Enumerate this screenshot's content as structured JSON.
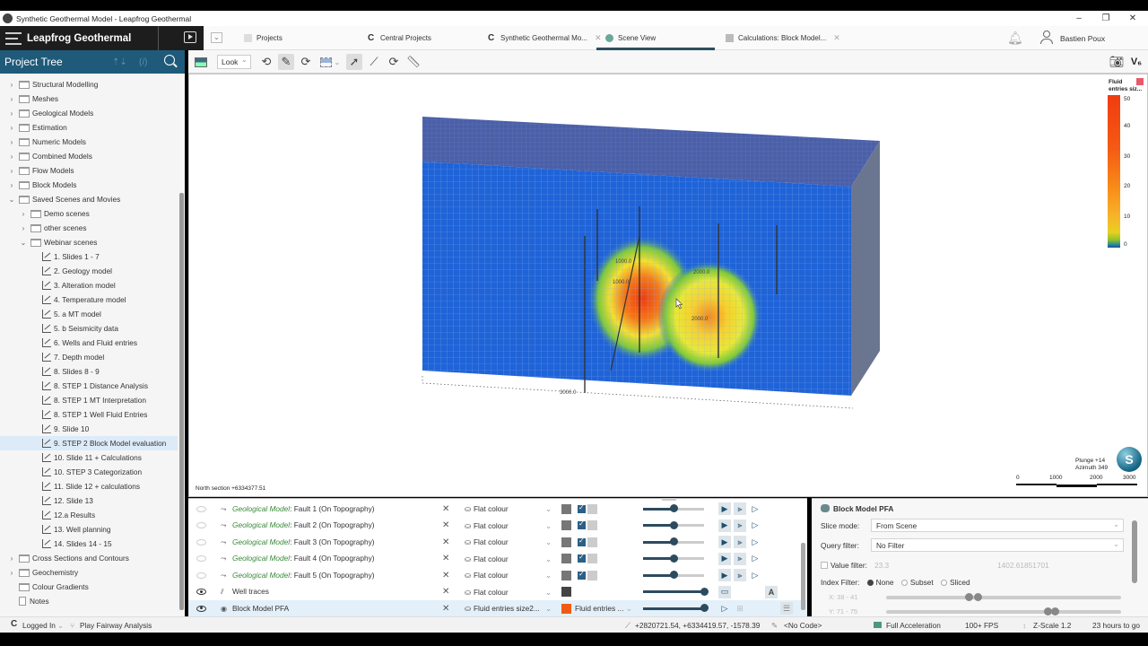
{
  "window": {
    "title": "Synthetic Geothermal Model - Leapfrog Geothermal",
    "controls": {
      "minimize": "–",
      "restore": "❐",
      "close": "✕"
    }
  },
  "brand": {
    "name": "Leapfrog Geothermal"
  },
  "tabs": [
    {
      "label": "Projects",
      "icon": "projects-icon",
      "active": false,
      "closable": false
    },
    {
      "label": "Central Projects",
      "icon": "central-icon",
      "active": false,
      "closable": false
    },
    {
      "label": "Synthetic Geothermal Mo...",
      "icon": "central-icon",
      "active": false,
      "closable": true
    },
    {
      "label": "Scene View",
      "icon": "scene-icon",
      "active": true,
      "closable": false
    },
    {
      "label": "Calculations: Block Model...",
      "icon": "calculations-icon",
      "active": false,
      "closable": true
    }
  ],
  "user": {
    "name": "Bastien Poux"
  },
  "project_tree": {
    "title": "Project Tree",
    "items": [
      {
        "label": "Structural Modelling",
        "level": 0,
        "type": "folder",
        "expanded": false
      },
      {
        "label": "Meshes",
        "level": 0,
        "type": "folder",
        "expanded": false
      },
      {
        "label": "Geological Models",
        "level": 0,
        "type": "folder",
        "expanded": false
      },
      {
        "label": "Estimation",
        "level": 0,
        "type": "folder",
        "expanded": false
      },
      {
        "label": "Numeric Models",
        "level": 0,
        "type": "folder",
        "expanded": false
      },
      {
        "label": "Combined Models",
        "level": 0,
        "type": "folder",
        "expanded": false
      },
      {
        "label": "Flow Models",
        "level": 0,
        "type": "folder",
        "expanded": false
      },
      {
        "label": "Block Models",
        "level": 0,
        "type": "folder",
        "expanded": false
      },
      {
        "label": "Saved Scenes and Movies",
        "level": 0,
        "type": "folder",
        "expanded": true
      },
      {
        "label": "Demo scenes",
        "level": 1,
        "type": "folder",
        "expanded": false
      },
      {
        "label": "other scenes",
        "level": 1,
        "type": "folder",
        "expanded": false
      },
      {
        "label": "Webinar scenes",
        "level": 1,
        "type": "folder",
        "expanded": true
      },
      {
        "label": "1. Slides 1 - 7",
        "level": 2,
        "type": "scene"
      },
      {
        "label": "2. Geology model",
        "level": 2,
        "type": "scene"
      },
      {
        "label": "3. Alteration model",
        "level": 2,
        "type": "scene"
      },
      {
        "label": "4. Temperature model",
        "level": 2,
        "type": "scene"
      },
      {
        "label": "5. a MT model",
        "level": 2,
        "type": "scene"
      },
      {
        "label": "5. b Seismicity data",
        "level": 2,
        "type": "scene"
      },
      {
        "label": "6. Wells and Fluid entries",
        "level": 2,
        "type": "scene"
      },
      {
        "label": "7. Depth model",
        "level": 2,
        "type": "scene"
      },
      {
        "label": "8. Slides 8 - 9",
        "level": 2,
        "type": "scene"
      },
      {
        "label": "8. STEP 1 Distance Analysis",
        "level": 2,
        "type": "scene"
      },
      {
        "label": "8. STEP 1 MT Interpretation",
        "level": 2,
        "type": "scene"
      },
      {
        "label": "8. STEP 1 Well Fluid Entries",
        "level": 2,
        "type": "scene"
      },
      {
        "label": "9. Slide 10",
        "level": 2,
        "type": "scene"
      },
      {
        "label": "9. STEP 2 Block Model evaluation",
        "level": 2,
        "type": "scene",
        "selected": true
      },
      {
        "label": "10. Slide 11 + Calculations",
        "level": 2,
        "type": "scene"
      },
      {
        "label": "10. STEP 3 Categorization",
        "level": 2,
        "type": "scene"
      },
      {
        "label": "11. Slide 12 + calculations",
        "level": 2,
        "type": "scene"
      },
      {
        "label": "12. Slide 13",
        "level": 2,
        "type": "scene"
      },
      {
        "label": "12.a Results",
        "level": 2,
        "type": "scene"
      },
      {
        "label": "13. Well planning",
        "level": 2,
        "type": "scene"
      },
      {
        "label": "14. Slides 14 - 15",
        "level": 2,
        "type": "scene"
      },
      {
        "label": "Cross Sections and Contours",
        "level": 0,
        "type": "folder",
        "expanded": false
      },
      {
        "label": "Geochemistry",
        "level": 0,
        "type": "folder",
        "expanded": false
      },
      {
        "label": "Colour Gradients",
        "level": 0,
        "type": "folder",
        "leaf": true
      },
      {
        "label": "Notes",
        "level": 0,
        "type": "note",
        "leaf": true
      }
    ]
  },
  "toolbar": {
    "view_mode": "Look"
  },
  "viewport": {
    "north_section": "North section +6334377.51",
    "well_labels": [
      "1000.0",
      "1000.0",
      "2000.0",
      "2000.0",
      "3000.0"
    ],
    "orientation": {
      "plunge": "Plunge +14",
      "azimuth": "Azimuth 349"
    },
    "compass_letter": "S",
    "scale_labels": [
      "0",
      "1000",
      "2000",
      "3000"
    ],
    "legend": {
      "title_line1": "Fluid",
      "title_line2": "entries siz...",
      "ticks": [
        "50",
        "40",
        "30",
        "20",
        "10",
        "0"
      ],
      "min": 0,
      "max": 50
    }
  },
  "shapes": [
    {
      "prefix": "Geological Model",
      "name": ": Fault 1 (On Topography)",
      "visible": false,
      "colour_mode": "Flat colour",
      "swatch": "#777777",
      "opacity": 0.5,
      "checked": true
    },
    {
      "prefix": "Geological Model",
      "name": ": Fault 2 (On Topography)",
      "visible": false,
      "colour_mode": "Flat colour",
      "swatch": "#777777",
      "opacity": 0.5,
      "checked": true
    },
    {
      "prefix": "Geological Model",
      "name": ": Fault 3 (On Topography)",
      "visible": false,
      "colour_mode": "Flat colour",
      "swatch": "#777777",
      "opacity": 0.5,
      "checked": true
    },
    {
      "prefix": "Geological Model",
      "name": ": Fault 4 (On Topography)",
      "visible": false,
      "colour_mode": "Flat colour",
      "swatch": "#777777",
      "opacity": 0.5,
      "checked": true
    },
    {
      "prefix": "Geological Model",
      "name": ": Fault 5 (On Topography)",
      "visible": false,
      "colour_mode": "Flat colour",
      "swatch": "#777777",
      "opacity": 0.5,
      "checked": true
    },
    {
      "prefix": "",
      "name": "Well traces",
      "visible": true,
      "colour_mode": "Flat colour",
      "swatch": "#444444",
      "opacity": 1.0
    },
    {
      "prefix": "",
      "name": "Block Model PFA",
      "visible": true,
      "colour_mode": "Fluid entries size2...",
      "colour_select": "Fluid entries ...",
      "swatch": "#f05a14",
      "opacity": 1.0,
      "selected": true
    }
  ],
  "properties": {
    "title": "Block Model PFA",
    "slice_mode_label": "Slice mode:",
    "slice_mode": "From Scene",
    "query_filter_label": "Query filter:",
    "query_filter": "No Filter",
    "value_filter_label": "Value filter:",
    "value_filter_min": "23.3",
    "value_filter_max": "1402.61851701",
    "index_filter_label": "Index Filter:",
    "index_options": [
      "None",
      "Subset",
      "Sliced"
    ],
    "index_selected": "None",
    "x_range_label": "X: 38 - 41",
    "y_range_label": "Y: 71 - 75"
  },
  "status": {
    "login": "Logged In",
    "branch": "Play Fairway Analysis",
    "coords": "+2820721.54, +6334419.57, -1578.39",
    "code": "<No Code>",
    "acceleration": "Full Acceleration",
    "fps": "100+ FPS",
    "zscale": "Z-Scale 1.2",
    "time": "23 hours to go"
  }
}
